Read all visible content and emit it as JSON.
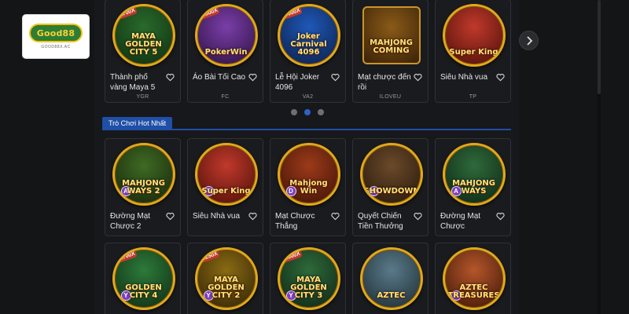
{
  "logo": {
    "brand": "Good88",
    "sub": "GOOD88X.AC"
  },
  "carousel": {
    "games": [
      {
        "title": "Thành phố vàng Maya 5",
        "provider": "YGR",
        "art": "MAYA GOLDEN CITY 5",
        "badge": "1700X",
        "colors": [
          "#2a6a2c",
          "#0d2e10"
        ]
      },
      {
        "title": "Áo Bài Tối Cao",
        "provider": "FC",
        "art": "PokerWin",
        "badge": "2500X",
        "colors": [
          "#7a3ea8",
          "#2c1040"
        ]
      },
      {
        "title": "Lễ Hội Joker 4096",
        "provider": "VA2",
        "art": "Joker Carnival 4096",
        "badge": "5000X",
        "colors": [
          "#1f58b8",
          "#0c1d45"
        ]
      },
      {
        "title": "Mạt chược đến rồi",
        "provider": "ILOVEU",
        "art": "MAHJONG COMING",
        "badge": "",
        "colors": [
          "#8a5a18",
          "#3a2208"
        ]
      },
      {
        "title": "Siêu Nhà vua",
        "provider": "TP",
        "art": "Super King",
        "badge": "",
        "colors": [
          "#c0392b",
          "#4a0e08"
        ]
      }
    ],
    "dots": 3,
    "active_dot": 1
  },
  "section": {
    "title": "Trò Chơi Hot Nhất"
  },
  "hot_row1": [
    {
      "title": "Đường Mạt Chược 2",
      "art": "MAHJONG WAYS 2",
      "chip": "A",
      "colors": [
        "#3f6a24",
        "#15240a"
      ]
    },
    {
      "title": "Siêu Nhà vua",
      "art": "Super King",
      "chip": "T",
      "colors": [
        "#c0392b",
        "#4a0e08"
      ]
    },
    {
      "title": "Mạt Chược Thắng",
      "art": "Mahjong Win",
      "chip": "D",
      "colors": [
        "#9c3a1a",
        "#3c1206"
      ]
    },
    {
      "title": "Quyết Chiến Tiền Thưởng",
      "art": "SHOWDOWN",
      "chip": "A",
      "colors": [
        "#6b4a2a",
        "#24160a"
      ]
    },
    {
      "title": "Đường Mạt Chược",
      "art": "MAHJONG WAYS",
      "chip": "A",
      "colors": [
        "#2f6a3a",
        "#0c2414"
      ]
    }
  ],
  "hot_row2": [
    {
      "art": "GOLDEN CITY 4",
      "badge": "1700X",
      "chip": "Y",
      "colors": [
        "#2d7a3a",
        "#0e2a14"
      ]
    },
    {
      "art": "MAYA GOLDEN CITY 2",
      "badge": "1250X",
      "chip": "Y",
      "colors": [
        "#8a6a12",
        "#2e2206"
      ]
    },
    {
      "art": "MAYA GOLDEN CITY 3",
      "badge": "1000X",
      "chip": "Y",
      "colors": [
        "#2f6a3a",
        "#0c2414"
      ]
    },
    {
      "art": "AZTEC",
      "badge": "",
      "chip": "",
      "colors": [
        "#5a7a8a",
        "#1a2a30"
      ]
    },
    {
      "art": "AZTEC TREASURES",
      "badge": "",
      "chip": "A",
      "colors": [
        "#b5562a",
        "#3a1406"
      ]
    }
  ],
  "icons": {
    "next": "chevron-right-icon",
    "favorite": "heart-outline-icon"
  }
}
